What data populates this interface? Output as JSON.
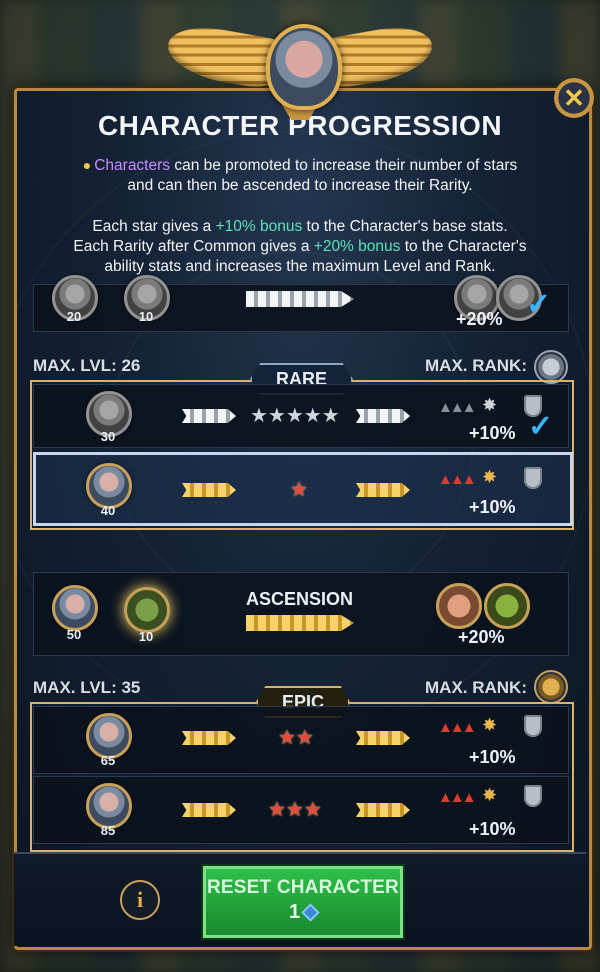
{
  "header": {
    "title": "CHARACTER PROGRESSION",
    "close_icon": "x-close-icon"
  },
  "intro": {
    "line1_highlight": "Characters",
    "line1_rest": " can be promoted to increase their number of stars",
    "line2": "and can then be ascended to increase their Rarity.",
    "p2_a": "Each star gives a ",
    "p2_bonus": "+10% bonus",
    "p2_b": " to the Character's base stats.",
    "p3_a": "Each Rarity after Common gives a ",
    "p3_bonus": "+20% bonus",
    "p3_b": " to the Character's",
    "p3_c": "ability stats and increases the maximum Level and Rank."
  },
  "top_row": {
    "avatar_num": "20",
    "item_num": "10",
    "bonus": "+20%",
    "completed": true
  },
  "rare": {
    "max_lvl": "MAX. LVL: 26",
    "max_rank": "MAX. RANK:",
    "tag": "RARE",
    "rows": [
      {
        "avatar_num": "30",
        "stars": "★★★★★",
        "bonus": "+10%",
        "completed": true
      },
      {
        "avatar_num": "40",
        "stars": "★",
        "bonus": "+10%",
        "completed": false
      }
    ]
  },
  "ascension": {
    "label": "ASCENSION",
    "avatar_num": "50",
    "item_num": "10",
    "bonus": "+20%"
  },
  "epic": {
    "max_lvl": "MAX. LVL: 35",
    "max_rank": "MAX. RANK:",
    "tag": "EPIC",
    "rows": [
      {
        "avatar_num": "65",
        "stars": "★★",
        "bonus": "+10%"
      },
      {
        "avatar_num": "85",
        "stars": "★★★",
        "bonus": "+10%"
      }
    ]
  },
  "footer": {
    "info_label": "i",
    "reset_label": "RESET CHARACTER",
    "reset_cost": "1"
  }
}
